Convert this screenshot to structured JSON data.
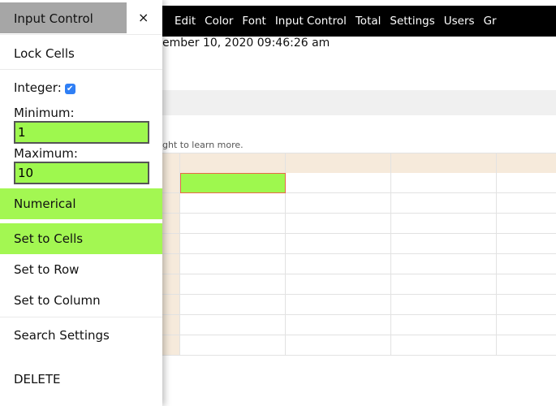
{
  "nav": {
    "items": [
      "Edit",
      "Color",
      "Font",
      "Input Control",
      "Total",
      "Settings",
      "Users",
      "Gr"
    ]
  },
  "date": "ember 10, 2020 09:46:26 am",
  "hint": "ght to learn more.",
  "menu": {
    "title": "Input Control",
    "close": "×",
    "lock": "Lock Cells",
    "integer_label": "Integer:",
    "integer_checked": true,
    "min_label": "Minimum:",
    "min_value": "1",
    "max_label": "Maximum:",
    "max_value": "10",
    "numerical": "Numerical",
    "set_cells": "Set to Cells",
    "set_row": "Set to Row",
    "set_column": "Set to Column",
    "search": "Search Settings",
    "delete": "DELETE"
  },
  "colors": {
    "highlight": "#a3f752",
    "header": "#f6eadb",
    "nav": "#000000"
  }
}
